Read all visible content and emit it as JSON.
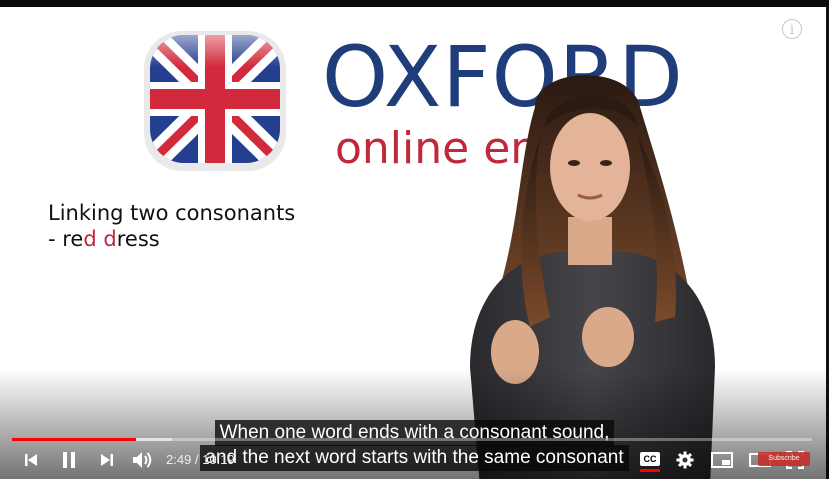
{
  "video": {
    "brand_name": "OXFORD",
    "brand_subtitle": "online english",
    "lesson_title": "Linking two consonants",
    "lesson_example_prefix": "- re",
    "lesson_example_hl1": "d",
    "lesson_example_mid": " ",
    "lesson_example_hl2": "d",
    "lesson_example_suffix": "ress",
    "info_icon_glyph": "i"
  },
  "subtitles": {
    "line1": "When one word ends with a consonant sound,",
    "line2": "and the next word starts with the same consonant"
  },
  "player": {
    "time_display": "2:49 / 10:19",
    "progress_fraction": 0.155,
    "buffer_fraction": 0.2,
    "cc_label": "CC",
    "subscribe_label": "Subscribe",
    "colors": {
      "progress": "#ff0000",
      "brand_blue": "#1f3d7a",
      "brand_red": "#c0283c"
    },
    "icons": [
      "previous-icon",
      "pause-icon",
      "next-icon",
      "volume-icon",
      "captions-icon",
      "settings-icon",
      "miniplayer-icon",
      "theater-icon",
      "fullscreen-icon",
      "info-icon"
    ]
  }
}
